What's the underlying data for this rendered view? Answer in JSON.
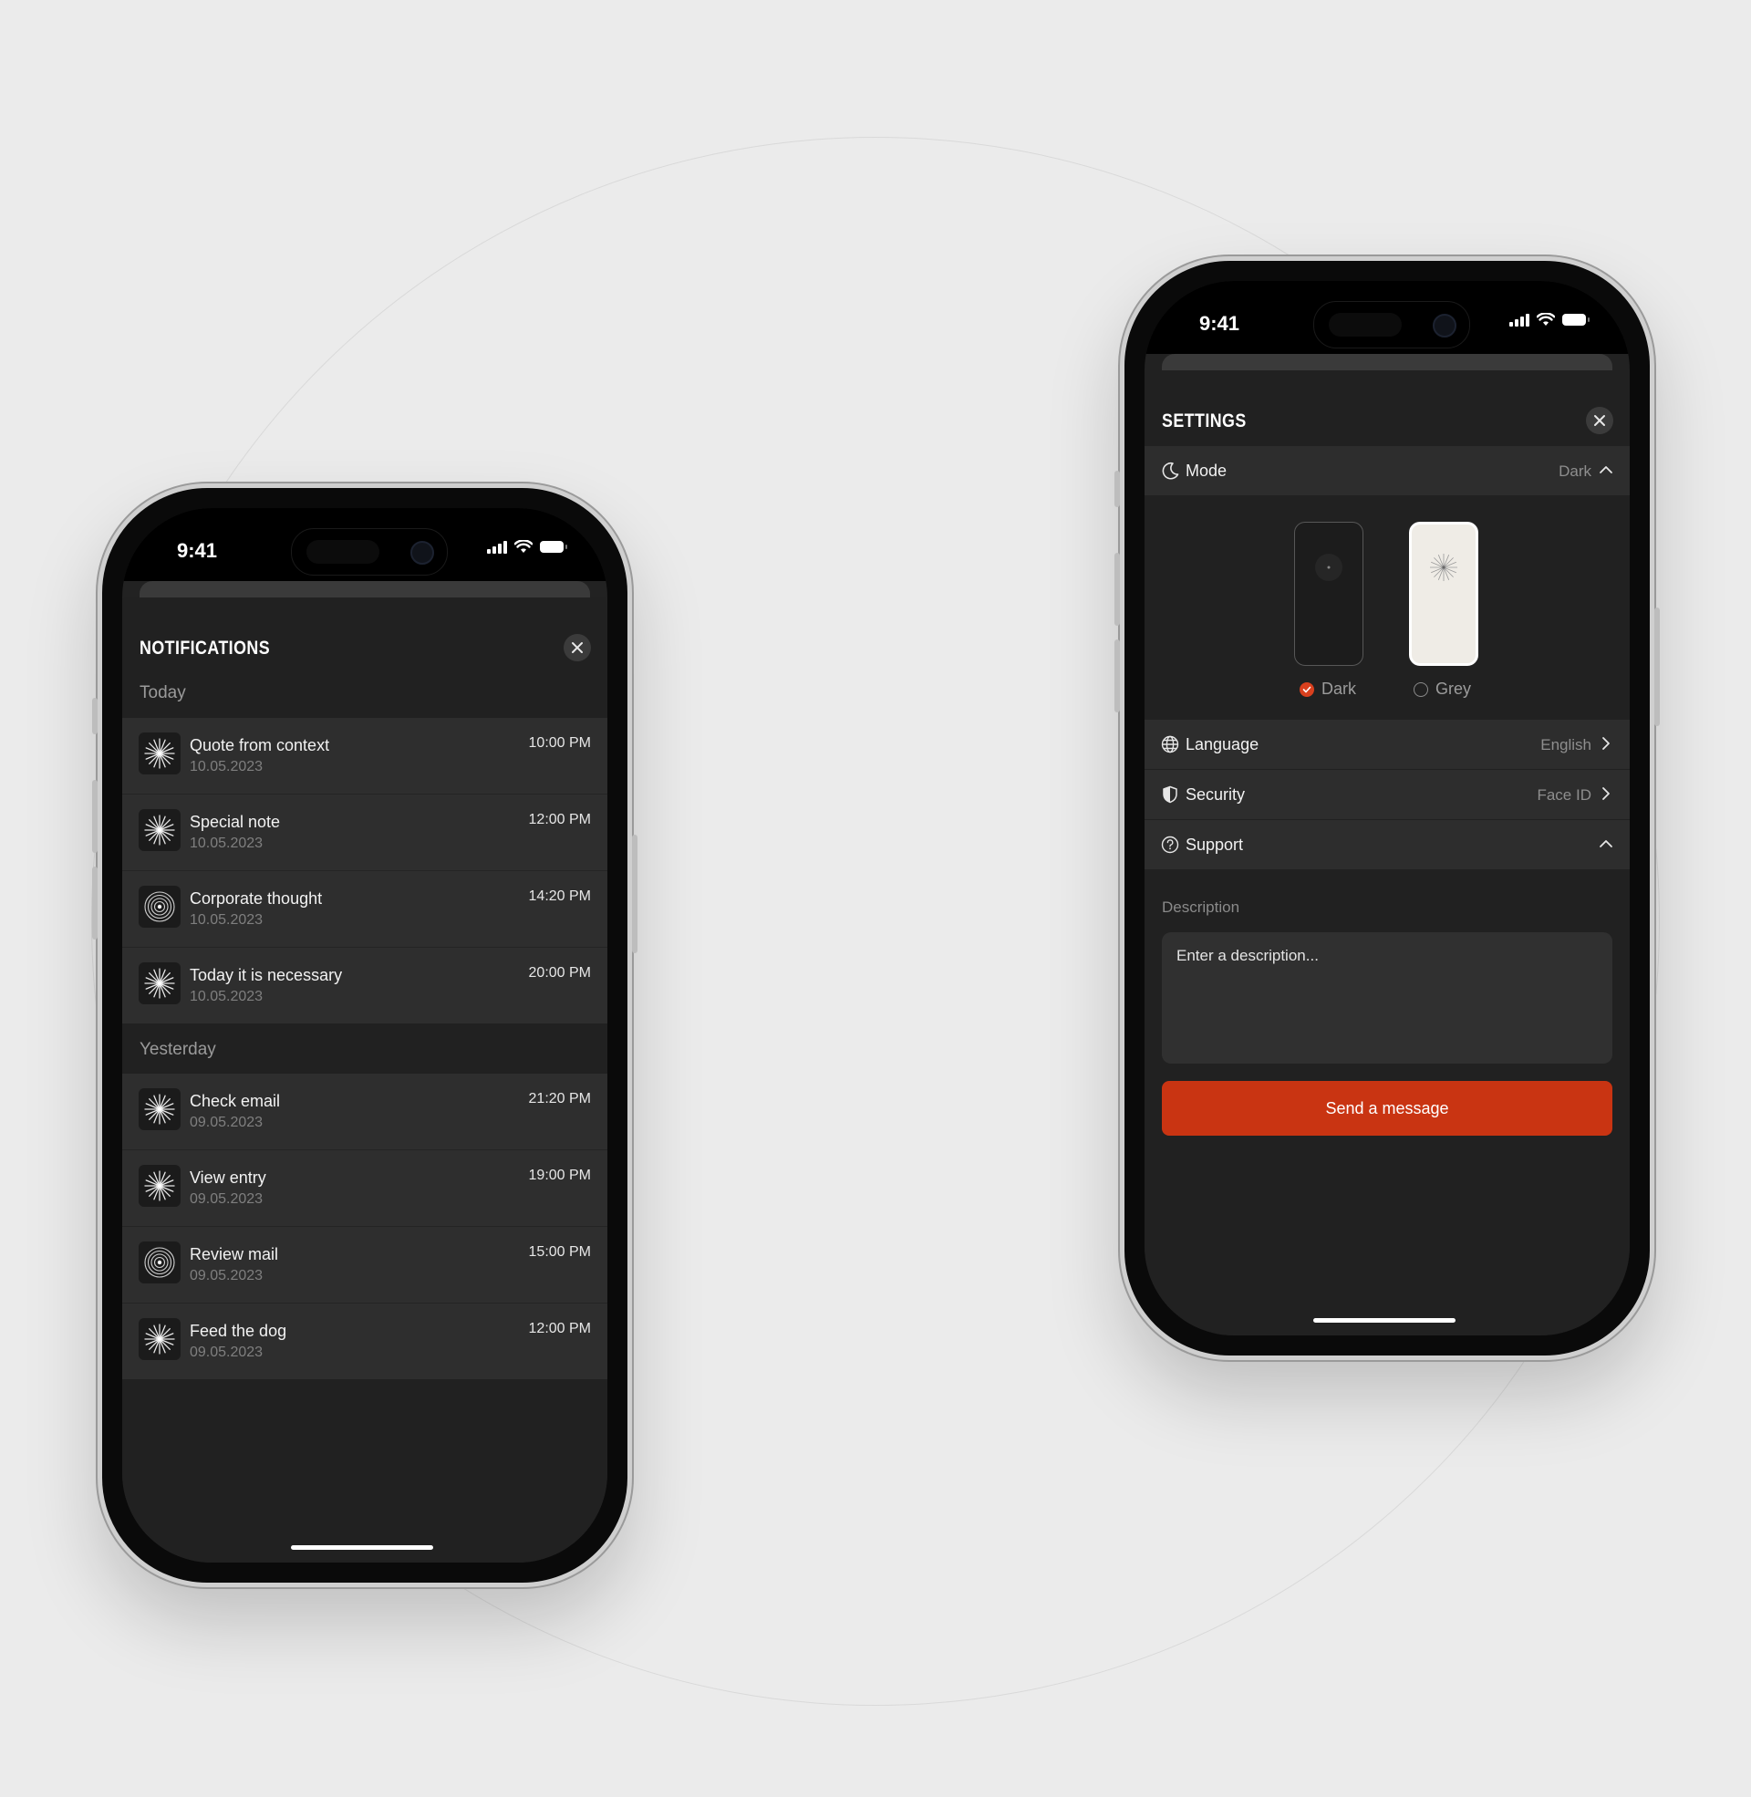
{
  "status_bar": {
    "time": "9:41"
  },
  "notifications": {
    "title": "NOTIFICATIONS",
    "close_icon": "close-icon",
    "sections": [
      {
        "label": "Today",
        "items": [
          {
            "title": "Quote from context",
            "date": "10.05.2023",
            "time": "10:00 PM",
            "icon": "starburst-icon"
          },
          {
            "title": "Special note",
            "date": "10.05.2023",
            "time": "12:00 PM",
            "icon": "starburst-icon"
          },
          {
            "title": "Corporate thought",
            "date": "10.05.2023",
            "time": "14:20 PM",
            "icon": "concentric-circles-icon"
          },
          {
            "title": "Today it is necessary",
            "date": "10.05.2023",
            "time": "20:00 PM",
            "icon": "starburst-icon"
          }
        ]
      },
      {
        "label": "Yesterday",
        "items": [
          {
            "title": "Check email",
            "date": "09.05.2023",
            "time": "21:20 PM",
            "icon": "starburst-icon"
          },
          {
            "title": "View entry",
            "date": "09.05.2023",
            "time": "19:00 PM",
            "icon": "starburst-icon"
          },
          {
            "title": "Review mail",
            "date": "09.05.2023",
            "time": "15:00 PM",
            "icon": "concentric-circles-icon"
          },
          {
            "title": "Feed the dog",
            "date": "09.05.2023",
            "time": "12:00 PM",
            "icon": "starburst-icon"
          }
        ]
      }
    ]
  },
  "settings": {
    "title": "SETTINGS",
    "mode": {
      "label": "Mode",
      "value": "Dark",
      "icon": "moon-icon"
    },
    "themes": [
      {
        "label": "Dark",
        "selected": true
      },
      {
        "label": "Grey",
        "selected": false
      }
    ],
    "language": {
      "label": "Language",
      "value": "English",
      "icon": "globe-icon"
    },
    "security": {
      "label": "Security",
      "value": "Face ID",
      "icon": "shield-icon"
    },
    "support": {
      "label": "Support",
      "icon": "question-circle-icon"
    },
    "description_label": "Description",
    "description_placeholder": "Enter a description...",
    "send_label": "Send a message"
  },
  "colors": {
    "accent": "#c93412",
    "background": "#ebebeb",
    "screen": "#212121",
    "card": "#2e2e2e"
  }
}
